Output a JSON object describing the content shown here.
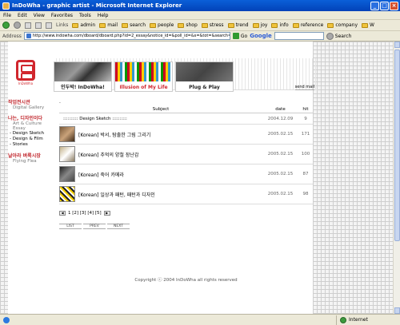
{
  "window": {
    "title": "InDoWha - graphic artist - Microsoft Internet Explorer"
  },
  "menu": [
    "File",
    "Edit",
    "View",
    "Favorites",
    "Tools",
    "Help"
  ],
  "links": {
    "label": "Links",
    "items": [
      "admin",
      "mail",
      "search",
      "people",
      "shop",
      "stress",
      "trend",
      "joy",
      "info",
      "reference",
      "company",
      "W"
    ]
  },
  "address": {
    "label": "Address",
    "url": "http://www.indowha.com/dboard/dboard.php?id=2_essay&notice_id=&poll_id=&s=&tot=&search=",
    "go": "Go"
  },
  "google": {
    "logo": "Google",
    "search": "Search"
  },
  "site": {
    "logo_text": "InDoWha",
    "banners": [
      "인두박! InDoWha!",
      "Illusion of My Life",
      "Plug & Play"
    ],
    "sendmail": "send mail"
  },
  "nav": {
    "sections": [
      {
        "title": "작업전시관",
        "sub": "Digital Gallery",
        "items": []
      },
      {
        "title": "나는, 디자인이다",
        "sub": "Art & Culture Essay",
        "items": [
          "- Design Sketch",
          "- Design & Film",
          "- Stories"
        ]
      },
      {
        "title": "날아라 벼룩시장",
        "sub": "Flying Flea",
        "items": []
      }
    ]
  },
  "board": {
    "dot": ".",
    "headers": {
      "subject": "Subject",
      "date": "date",
      "hit": "hit"
    },
    "notice": {
      "subject": ":::::::::: Design Sketch ::::::::::",
      "date": "2004.12.09",
      "hit": "9"
    },
    "rows": [
      {
        "subject": "[Korean] 박서, 탐출한 그림 그리기",
        "date": "2005.02.15",
        "hit": "171"
      },
      {
        "subject": "[Korean] 추억의 양철 장난감",
        "date": "2005.02.15",
        "hit": "100"
      },
      {
        "subject": "[Korean] 죽어 카메라",
        "date": "2005.02.15",
        "hit": "87"
      },
      {
        "subject": "[Korean] 일상과 패턴, 패턴과 디자인",
        "date": "2005.02.15",
        "hit": "98"
      }
    ],
    "pager": "1 [2] [3] [4] [5]",
    "actions": [
      "LIST",
      "PREV",
      "NEXT"
    ],
    "copyright": "Copyright ⓒ 2004 InDoWha all rights reserved"
  },
  "status": {
    "zone": "Internet"
  }
}
